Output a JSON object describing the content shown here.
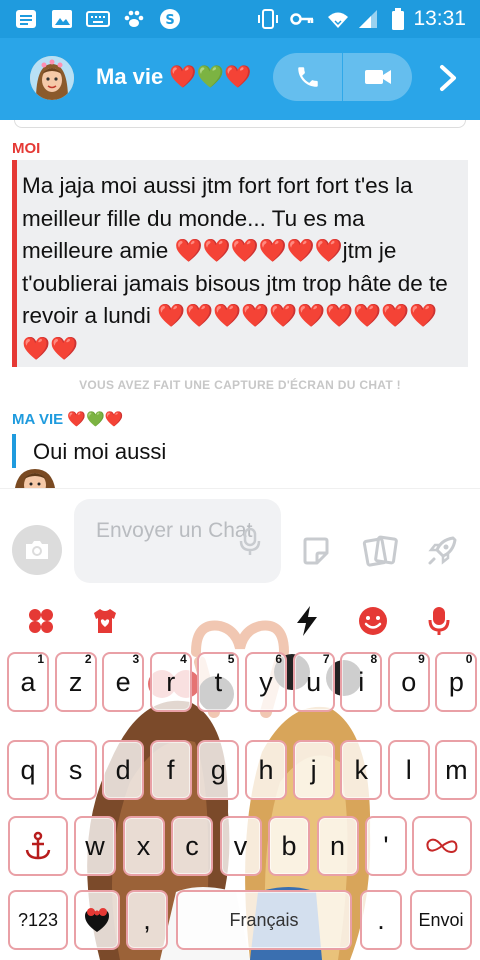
{
  "status_bar": {
    "time": "13:31",
    "icons": [
      "message-icon",
      "image-icon",
      "keyboard-icon",
      "paw-icon",
      "shazam-icon",
      "vibrate-icon",
      "vpn-key-icon",
      "wifi-icon",
      "signal-icon",
      "battery-icon"
    ]
  },
  "header": {
    "title": "Ma vie ❤️💚❤️",
    "icons": [
      "avatar",
      "phone-icon",
      "video-icon",
      "chevron-right-icon"
    ]
  },
  "chat": {
    "me_label": "MOI",
    "me_message": "Ma jaja moi aussi jtm fort fort fort t'es la meilleur fille du monde... Tu es ma meilleure amie ❤️❤️❤️❤️❤️❤️jtm je t'oublierai jamais bisous jtm trop hâte de te revoir a lundi ❤️❤️❤️❤️❤️❤️❤️❤️❤️❤️❤️❤️",
    "screenshot_notice": "VOUS AVEZ FAIT UNE CAPTURE D'ÉCRAN DU CHAT !",
    "her_label": "MA VIE ❤️💚❤️",
    "her_message": "Oui moi aussi"
  },
  "composer": {
    "placeholder": "Envoyer un Chat",
    "icons": [
      "camera-icon",
      "microphone-icon",
      "sticker-icon",
      "cards-icon",
      "rocket-icon"
    ]
  },
  "keyboard": {
    "toolbar_icons": [
      "clover-icon",
      "shirt-heart-icon",
      "bolt-icon",
      "emoji-icon",
      "microphone-icon"
    ],
    "row1": [
      {
        "label": "a",
        "hint": "1"
      },
      {
        "label": "z",
        "hint": "2"
      },
      {
        "label": "e",
        "hint": "3"
      },
      {
        "label": "r",
        "hint": "4"
      },
      {
        "label": "t",
        "hint": "5"
      },
      {
        "label": "y",
        "hint": "6"
      },
      {
        "label": "u",
        "hint": "7"
      },
      {
        "label": "i",
        "hint": "8"
      },
      {
        "label": "o",
        "hint": "9"
      },
      {
        "label": "p",
        "hint": "0"
      }
    ],
    "row2": [
      "q",
      "s",
      "d",
      "f",
      "g",
      "h",
      "j",
      "k",
      "l",
      "m"
    ],
    "row3": [
      "w",
      "x",
      "c",
      "v",
      "b",
      "n",
      "'"
    ],
    "shift_icon": "anchor-icon",
    "backspace_icon": "infinity-backspace-icon",
    "row4": {
      "symbols": "?123",
      "emoji_icon": "bow-heart-icon",
      "comma": ",",
      "space": "Français",
      "period": ".",
      "enter": "Envoi"
    }
  }
}
